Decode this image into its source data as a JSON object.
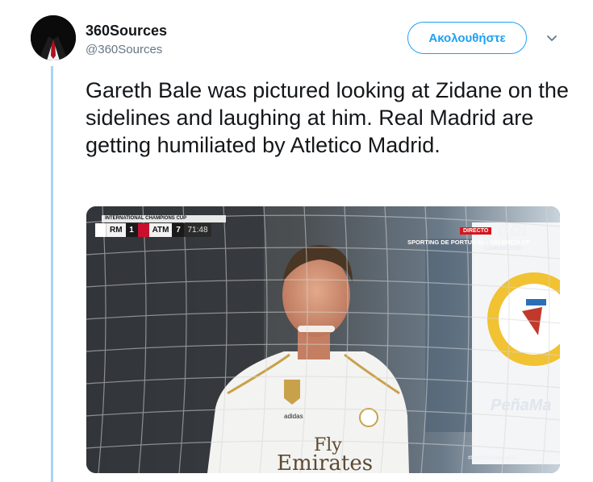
{
  "tweet": {
    "author": {
      "display_name": "360Sources",
      "handle": "@360Sources",
      "avatar_icon": "suit-avatar-icon"
    },
    "follow_label": "Ακολουθήστε",
    "menu_icon": "chevron-down-icon",
    "text": "Gareth Bale was pictured looking at Zidane on the sidelines and laughing at him. Real Madrid are getting humiliated by Atletico Madrid."
  },
  "media": {
    "scoreboard": {
      "competition": "INTERNATIONAL CHAMPIONS CUP",
      "home_team": "RM",
      "home_score": "1",
      "away_team": "ATM",
      "away_score": "7",
      "clock": "71:48"
    },
    "broadcaster": {
      "live_label": "DIRECTO",
      "logo": "GOL",
      "next_match": "SPORTING DE PORTUGAL - VALENCIA CF",
      "next_time": "DOMINGO 20:00"
    },
    "hashtag": "#MadridAtletiEnGol",
    "shirt_brand": "adidas",
    "shirt_sponsor_line1": "Fly",
    "shirt_sponsor_line2": "Emirates",
    "banner_text": "PeñaMa"
  },
  "colors": {
    "accent": "#1da1f2",
    "thread_line": "#a8d5f3",
    "handle_gray": "#657786"
  }
}
